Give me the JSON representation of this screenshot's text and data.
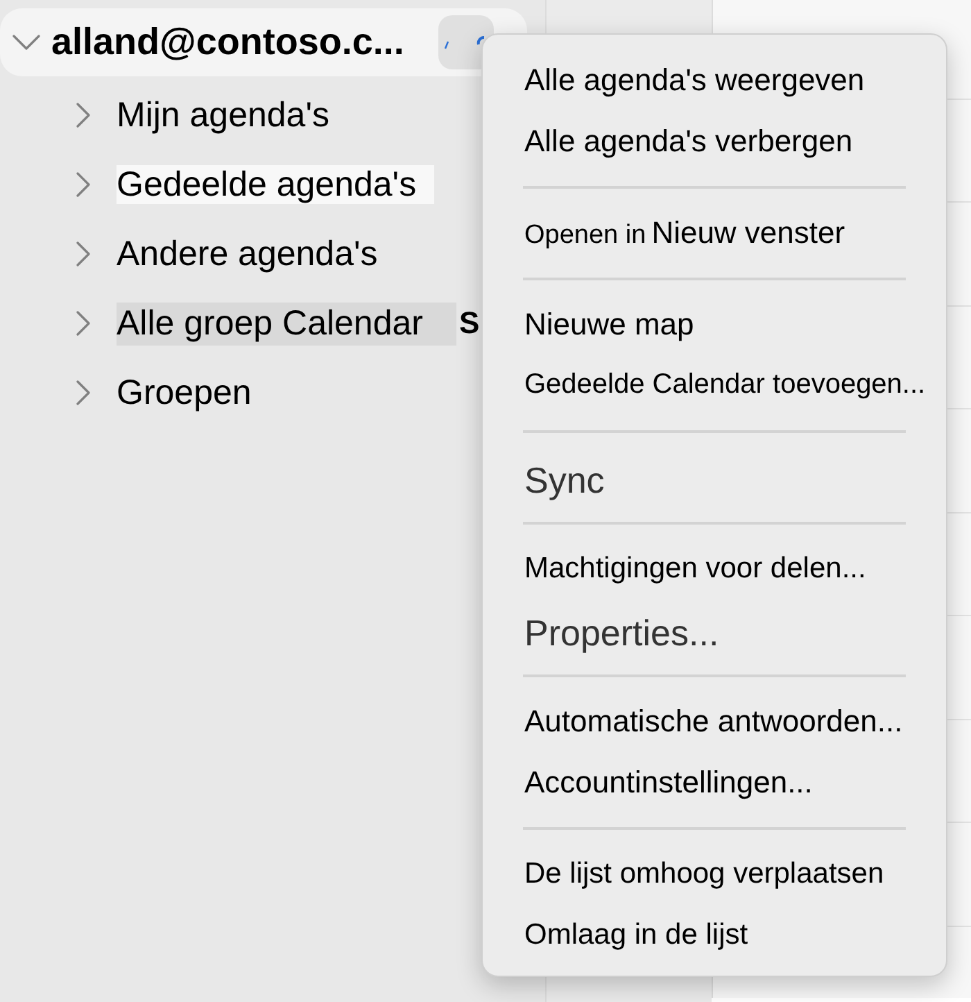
{
  "account": {
    "email": "alland@contoso.c...",
    "expanded": true
  },
  "folders": [
    {
      "label": "Mijn agenda's",
      "expanded": false,
      "selected": false,
      "hovered": false
    },
    {
      "label": "Gedeelde agenda's",
      "expanded": false,
      "selected": false,
      "hovered": true
    },
    {
      "label": "Andere agenda's",
      "expanded": false,
      "selected": false,
      "hovered": false
    },
    {
      "label": "Alle groep Calendar",
      "expanded": false,
      "selected": true,
      "hovered": false,
      "trailing_text": "S"
    },
    {
      "label": "Groepen",
      "expanded": false,
      "selected": false,
      "hovered": false
    }
  ],
  "context_menu": {
    "sections": [
      [
        {
          "label": "Alle agenda's weergeven"
        },
        {
          "label": "Alle agenda's verbergen"
        }
      ],
      [
        {
          "label": "Openen in",
          "value": "Nieuw venster"
        }
      ],
      [
        {
          "label": "Nieuwe map"
        },
        {
          "label": "Gedeelde Calendar toevoegen..."
        }
      ],
      [
        {
          "label": "Sync"
        }
      ],
      [
        {
          "label": "Machtigingen voor delen..."
        },
        {
          "label": "Properties..."
        }
      ],
      [
        {
          "label": "Automatische antwoorden..."
        },
        {
          "label": "Accountinstellingen..."
        }
      ],
      [
        {
          "label": "De lijst omhoog verplaatsen"
        },
        {
          "label": "Omlaag in de lijst"
        }
      ]
    ]
  }
}
